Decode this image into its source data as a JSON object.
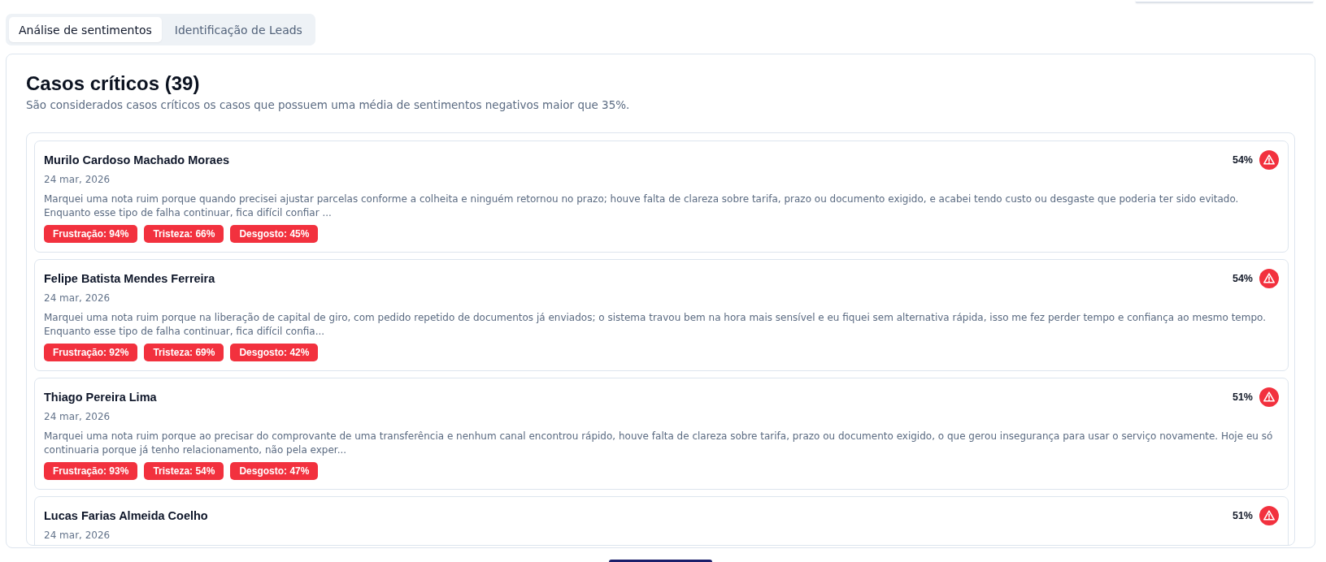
{
  "tabs": [
    {
      "label": "Análise de sentimentos",
      "selected": true
    },
    {
      "label": "Identificação de Leads",
      "selected": false
    }
  ],
  "section": {
    "title": "Casos críticos (39)",
    "description": "São considerados casos críticos os casos que possuem uma média de sentimentos negativos maior que 35%."
  },
  "cases": [
    {
      "name": "Murilo Cardoso Machado Moraes",
      "date": "24 mar, 2026",
      "score": "54%",
      "text": "Marquei uma nota ruim porque quando precisei ajustar parcelas conforme a colheita e ninguém retornou no prazo; houve falta de clareza sobre tarifa, prazo ou documento exigido, e acabei tendo custo ou desgaste que poderia ter sido evitado. Enquanto esse tipo de falha continuar, fica difícil confiar ...",
      "emotions": [
        "Frustração: 94%",
        "Tristeza: 66%",
        "Desgosto: 45%"
      ]
    },
    {
      "name": "Felipe Batista Mendes Ferreira",
      "date": "24 mar, 2026",
      "score": "54%",
      "text": "Marquei uma nota ruim porque na liberação de capital de giro, com pedido repetido de documentos já enviados; o sistema travou bem na hora mais sensível e eu fiquei sem alternativa rápida, isso me fez perder tempo e confiança ao mesmo tempo. Enquanto esse tipo de falha continuar, fica difícil confia...",
      "emotions": [
        "Frustração: 92%",
        "Tristeza: 69%",
        "Desgosto: 42%"
      ]
    },
    {
      "name": "Thiago Pereira Lima",
      "date": "24 mar, 2026",
      "score": "51%",
      "text": "Marquei uma nota ruim porque ao precisar do comprovante de uma transferência e nenhum canal encontrou rápido, houve falta de clareza sobre tarifa, prazo ou documento exigido, o que gerou insegurança para usar o serviço novamente. Hoje eu só continuaria porque já tenho relacionamento, não pela exper...",
      "emotions": [
        "Frustração: 93%",
        "Tristeza: 54%",
        "Desgosto: 47%"
      ]
    },
    {
      "name": "Lucas Farias Almeida Coelho",
      "date": "24 mar, 2026",
      "score": "51%"
    }
  ]
}
